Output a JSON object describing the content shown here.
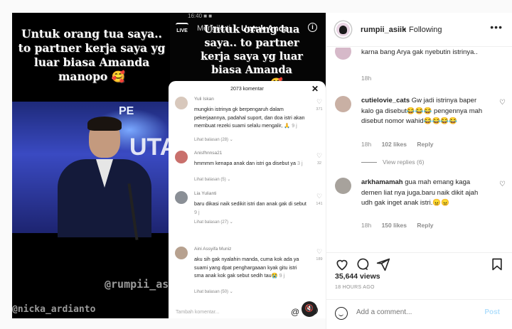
{
  "left_video": {
    "caption": "Untuk orang tua saya.. to partner kerja saya yg luar biasa Amanda manopo 🥰",
    "stage_logo": "PE",
    "stage_logo2": "UTA",
    "watermark_1": "@rumpii_asiik",
    "watermark_2": "@nicka_ardianto"
  },
  "right_video": {
    "status": "16:40 ■ ■",
    "live_label": "LIVE",
    "tab_following": "Mengikuti",
    "tab_for_you": "Untuk Anda",
    "info_icon": "i",
    "caption": "Untuk orang tua saya.. to partner kerja saya yg luar biasa Amanda manopo 🥰"
  },
  "sheet": {
    "title": "2073 komentar",
    "close": "✕",
    "add_placeholder": "Tambah komentar...",
    "at": "@",
    "comments": [
      {
        "name": "Yuli Iskan",
        "text": "mungkin istrinya gk berpengaruh dalam pekerjaannya, padahal suport, dan doa istri akan membuat rezeki suami selalu mengalir, 🙏",
        "time": "9 j",
        "replies": "Lihat balasan (28) ⌄",
        "count": "371"
      },
      {
        "name": "Anisfhnnsa21",
        "text": "hmmmm kenapa anak dan istri ga disebut ya",
        "time": "3 j",
        "replies": "Lihat balasan (5) ⌄",
        "count": "32"
      },
      {
        "name": "Lia Yulianti",
        "text": "baru dikasi naik sedikit istri dan anak gak di sebut",
        "time": "9 j",
        "replies": "Lihat balasan (27) ⌄",
        "count": "141"
      },
      {
        "name": "Aini Assyifa Muniz",
        "text": "aku sih gak nyalahin manda, cuma kok ada ya suami yang dpat penghargaaan kyak gitu istri sma anak kok gak sebut sedih tau😭",
        "time": "9 j",
        "replies": "Lihat balasan (50) ⌄",
        "count": "189"
      }
    ]
  },
  "post": {
    "username": "rumpii_asiik",
    "separator": "•",
    "follow_status": "Following",
    "more": "•••",
    "comments": [
      {
        "username": "",
        "text": "karna bang Arya gak nyebutin istrinya..",
        "time": "18h",
        "likes": "",
        "reply": "Reply"
      },
      {
        "username": "cutielovie_cats",
        "text": "Gw jadi istrinya baper kalo ga disebut😂😂😂 pengennya mah disebut nomor wahid😂😂😂😂",
        "time": "18h",
        "likes": "102 likes",
        "reply": "Reply",
        "view_replies": "View replies (6)"
      },
      {
        "username": "arkhamamah",
        "text": "gua mah emang kaga demen liat nya juga.baru naik dikit ajah udh gak inget anak istri.😠😠",
        "time": "18h",
        "likes": "150 likes",
        "reply": "Reply"
      }
    ],
    "likes_count": "35,644 views",
    "time_ago": "18 HOURS AGO",
    "add_comment_placeholder": "Add a comment...",
    "post_button": "Post"
  }
}
